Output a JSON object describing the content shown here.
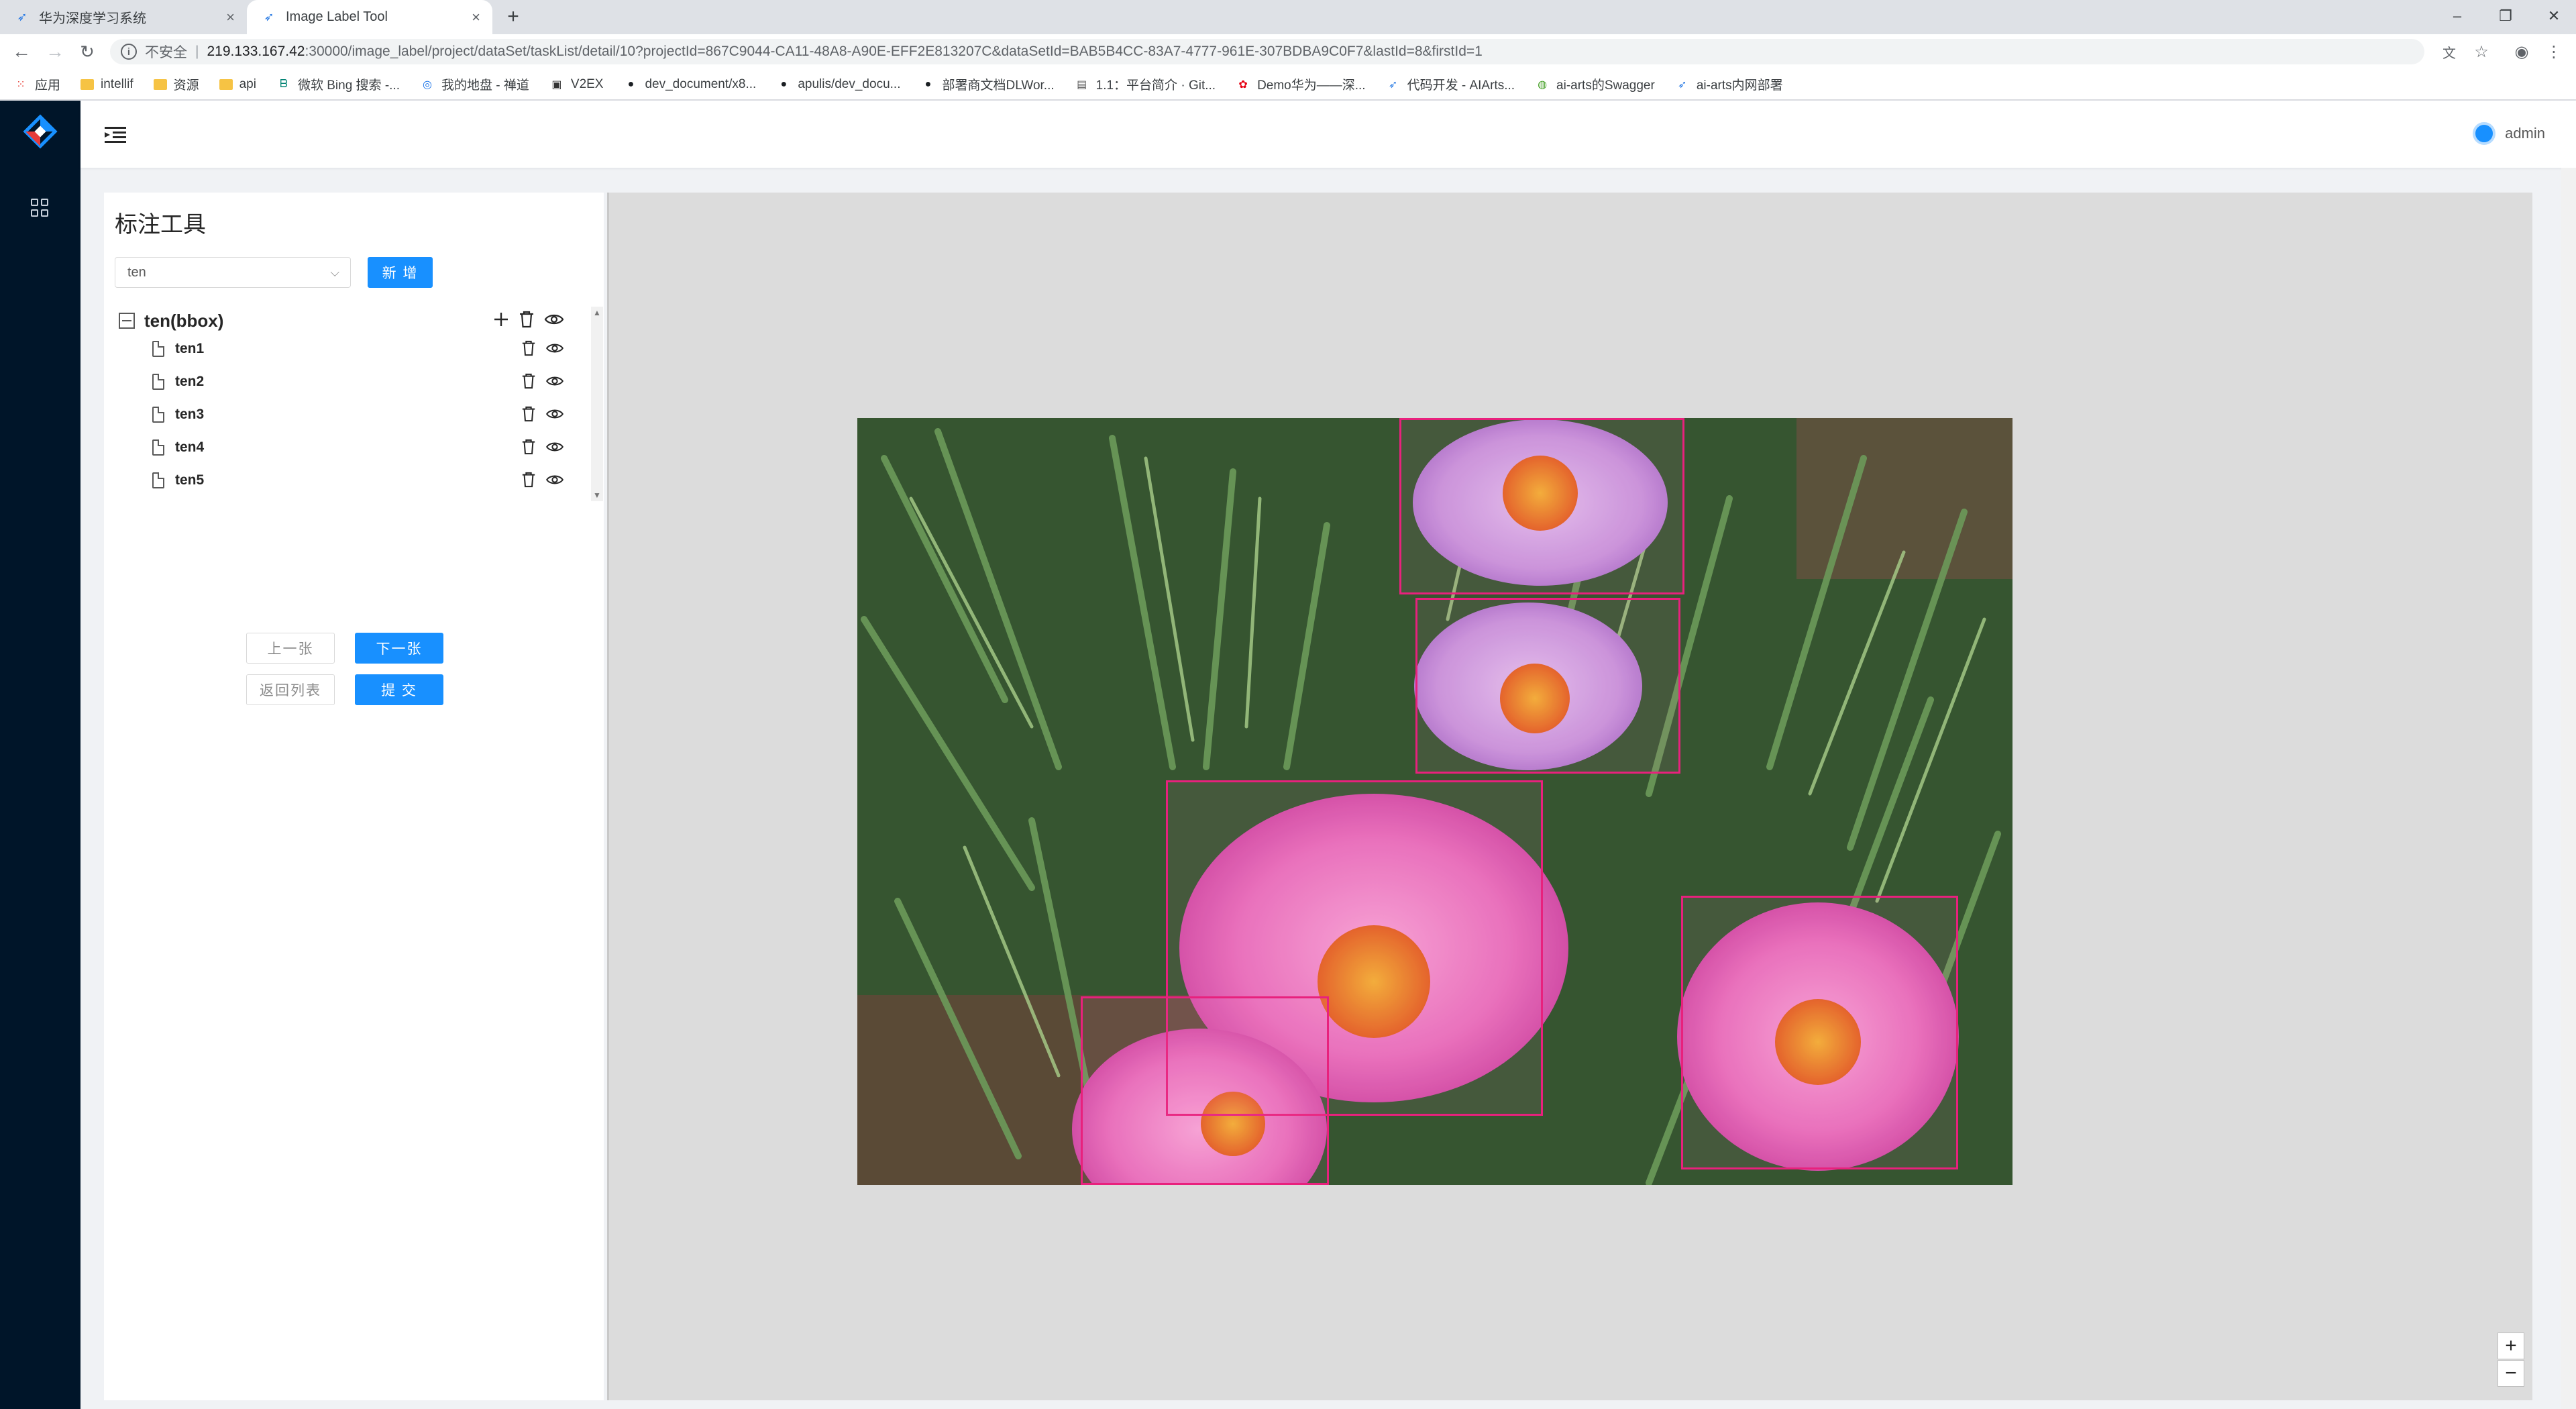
{
  "browser": {
    "tabs": [
      {
        "title": "华为深度学习系统"
      },
      {
        "title": "Image Label Tool"
      }
    ],
    "url": {
      "security": "不安全",
      "host": "219.133.167.42",
      "path": ":30000/image_label/project/dataSet/taskList/detail/10?projectId=867C9044-CA11-48A8-A90E-EFF2E813207C&dataSetId=BAB5B4CC-83A7-4777-961E-307BDBA9C0F7&lastId=8&firstId=1"
    },
    "bookmarks": [
      {
        "label": "应用",
        "icon": "apps-grid-icon"
      },
      {
        "label": "intellif",
        "icon": "folder-icon"
      },
      {
        "label": "资源",
        "icon": "folder-icon"
      },
      {
        "label": "api",
        "icon": "folder-icon"
      },
      {
        "label": "微软 Bing 搜索 -...",
        "icon": "bing-icon"
      },
      {
        "label": "我的地盘 - 禅道",
        "icon": "zentao-icon"
      },
      {
        "label": "V2EX",
        "icon": "v2ex-icon"
      },
      {
        "label": "dev_document/x8...",
        "icon": "github-icon"
      },
      {
        "label": "apulis/dev_docu...",
        "icon": "github-icon"
      },
      {
        "label": "部署商文档DLWor...",
        "icon": "github-icon"
      },
      {
        "label": "1.1：平台简介 · Git...",
        "icon": "book-icon"
      },
      {
        "label": "Demo华为——深...",
        "icon": "huawei-icon"
      },
      {
        "label": "代码开发 - AIArts...",
        "icon": "aiarts-icon"
      },
      {
        "label": "ai-arts的Swagger",
        "icon": "swagger-icon"
      },
      {
        "label": "ai-arts内网部署",
        "icon": "aiarts-icon"
      }
    ]
  },
  "header": {
    "username": "admin"
  },
  "panel": {
    "title": "标注工具",
    "select_value": "ten",
    "add_button": "新 增",
    "tree": {
      "root": "ten(bbox)",
      "children": [
        "ten1",
        "ten2",
        "ten3",
        "ten4",
        "ten5"
      ]
    },
    "buttons": {
      "prev": "上一张",
      "next": "下一张",
      "back": "返回列表",
      "submit": "提 交"
    }
  },
  "canvas": {
    "annotation_color": "#e8217d",
    "zoom_in": "+",
    "zoom_out": "−"
  },
  "colors": {
    "primary": "#1890ff",
    "sider": "#001529"
  }
}
